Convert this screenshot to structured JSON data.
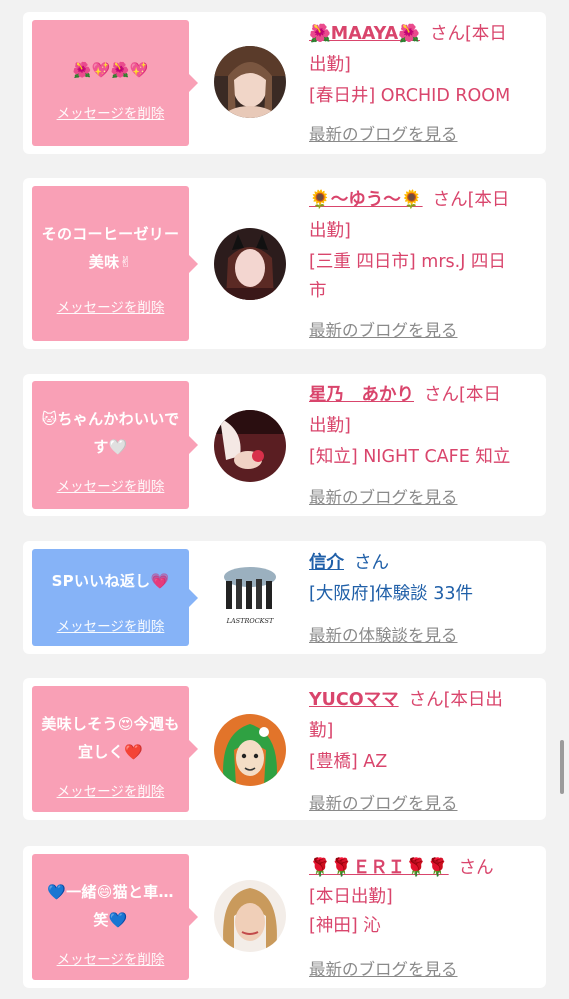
{
  "items": [
    {
      "message": "🌺💖🌺💖",
      "delete_label": "メッセージを削除",
      "bubble_color": "#f9a0b6",
      "name": "🌺MAAYA🌺",
      "suffix": "さん[本日",
      "info_line2": "出勤]",
      "info_line3": "[春日井] ORCHID ROOM",
      "info_line4": "",
      "link": "最新のブログを見る",
      "avatar_icon": "avatar-photo-woman"
    },
    {
      "message": "そのコーヒーゼリー美味✌",
      "delete_label": "メッセージを削除",
      "bubble_color": "#f9a0b6",
      "name": "🌻〜ゆう〜🌻",
      "suffix": "さん[本日",
      "info_line2": "出勤]",
      "info_line3": "[三重 四日市] mrs.J 四日",
      "info_line4": "市",
      "link": "最新のブログを見る",
      "avatar_icon": "avatar-photo-cat-ears"
    },
    {
      "message": "🐱ちゃんかわいいです🤍",
      "delete_label": "メッセージを削除",
      "bubble_color": "#f9a0b6",
      "name": "星乃　あかり",
      "suffix": "さん[本日",
      "info_line2": "出勤]",
      "info_line3": "[知立] NIGHT CAFE 知立",
      "info_line4": "",
      "link": "最新のブログを見る",
      "avatar_icon": "avatar-photo-hands"
    },
    {
      "message": "SPいいね返し💗",
      "delete_label": "メッセージを削除",
      "bubble_color": "#86b3f7",
      "name": "信介",
      "suffix": "さん",
      "info_line2": "[大阪府]体験談 33件",
      "info_line3": "",
      "info_line4": "",
      "link": "最新の体験談を見る",
      "avatar_icon": "avatar-band-logo",
      "avatar_caption": "LASTROCKST"
    },
    {
      "message": "美味しそう😍今週も宜しく❤️",
      "delete_label": "メッセージを削除",
      "bubble_color": "#f9a0b6",
      "name": "YUCOママ",
      "suffix": "さん[本日出",
      "info_line2": "勤]",
      "info_line3": "[豊橋] AZ",
      "info_line4": "",
      "link": "最新のブログを見る",
      "avatar_icon": "avatar-illustration-green-hair"
    },
    {
      "message": "💙一緒😄猫と車…笑💙",
      "delete_label": "メッセージを削除",
      "bubble_color": "#f9a0b6",
      "name": "🌹🌹ＥＲＩ🌹🌹",
      "suffix": "さん",
      "info_line2": "[本日出勤]",
      "info_line3": "[神田] 沁",
      "info_line4": "",
      "link": "最新のブログを見る",
      "avatar_icon": "avatar-photo-blonde"
    }
  ]
}
